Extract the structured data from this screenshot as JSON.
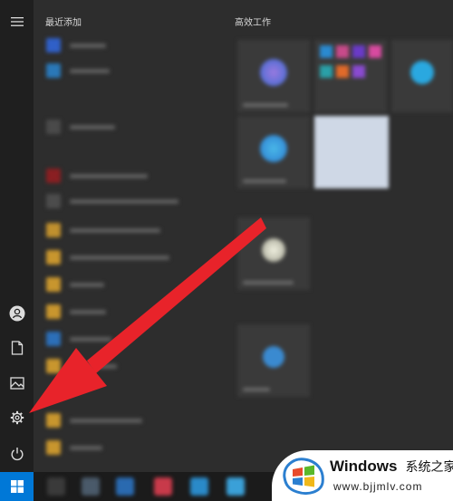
{
  "start_menu": {
    "recent_header": "最近添加",
    "productivity_header": "高效工作"
  },
  "rail": {
    "items": [
      {
        "name": "expand-menu",
        "icon": "hamburger-icon"
      },
      {
        "name": "account",
        "icon": "user-avatar-icon"
      },
      {
        "name": "documents",
        "icon": "document-icon"
      },
      {
        "name": "pictures",
        "icon": "picture-icon"
      },
      {
        "name": "settings",
        "icon": "gear-icon"
      },
      {
        "name": "power",
        "icon": "power-icon"
      }
    ]
  },
  "watermark": {
    "brand": "Windows",
    "suffix": "系统之家",
    "url": "www.bjjmlv.com"
  },
  "colors": {
    "start_button": "#0078d7",
    "arrow": "#e8232a",
    "rail": "#1f1f1f",
    "panel": "#2d2d2d"
  }
}
